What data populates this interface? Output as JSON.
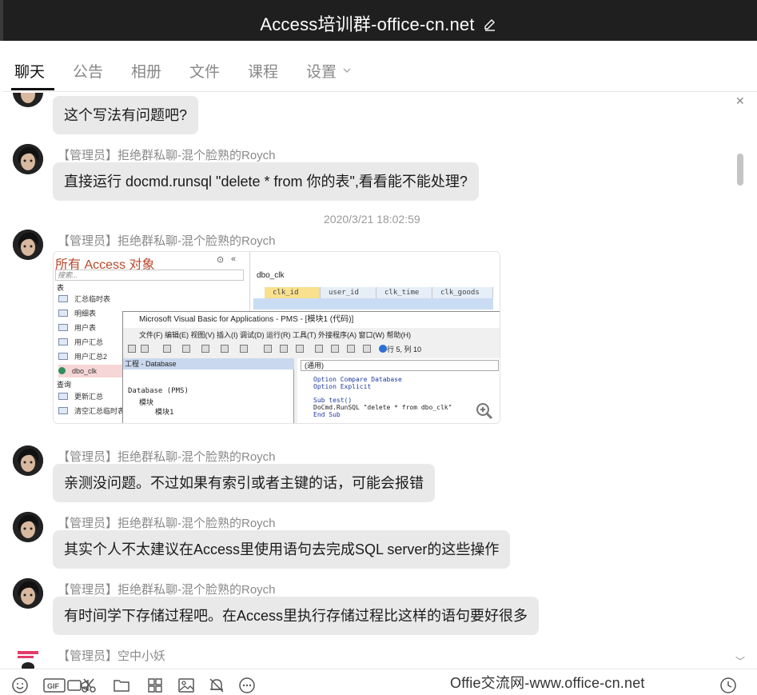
{
  "window": {
    "title": "Access培训群-office-cn.net"
  },
  "tabs": [
    {
      "label": "聊天"
    },
    {
      "label": "公告"
    },
    {
      "label": "相册"
    },
    {
      "label": "文件"
    },
    {
      "label": "课程"
    },
    {
      "label": "设置"
    }
  ],
  "messages": {
    "m1": {
      "text": "这个写法有问题吧?"
    },
    "m2": {
      "sender": "【管理员】拒绝群私聊-混个脸熟的Roych",
      "text": "直接运行 docmd.runsql \"delete * from 你的表\",看看能不能处理?"
    },
    "timestamp": "2020/3/21 18:02:59",
    "m3": {
      "sender": "【管理员】拒绝群私聊-混个脸熟的Roych"
    },
    "m4": {
      "sender": "【管理员】拒绝群私聊-混个脸熟的Roych",
      "text": "亲测没问题。不过如果有索引或者主键的话，可能会报错"
    },
    "m5": {
      "sender": "【管理员】拒绝群私聊-混个脸熟的Roych",
      "text": "其实个人不太建议在Access里使用语句去完成SQL server的这些操作"
    },
    "m6": {
      "sender": "【管理员】拒绝群私聊-混个脸熟的Roych",
      "text": "有时间学下存储过程吧。在Access里执行存储过程比这样的语句要好很多"
    },
    "m7": {
      "sender": "【管理员】空中小妖"
    }
  },
  "screenshot": {
    "nav": {
      "title": "所有 Access 对象",
      "search_placeholder": "搜索...",
      "section_tables": "表",
      "section_queries": "查询",
      "items": [
        "汇总临时表",
        "明细表",
        "用户表",
        "用户汇总",
        "用户汇总2",
        "dbo_clk"
      ],
      "query_items": [
        "更新汇总",
        "清空汇总临时表"
      ]
    },
    "table": {
      "tab": "dbo_clk",
      "columns": [
        "clk_id",
        "user_id",
        "clk_time",
        "clk_goods"
      ]
    },
    "vbe": {
      "title": "Microsoft Visual Basic for Applications - PMS - [模块1 (代码)]",
      "menu": "文件(F)   编辑(E)   视图(V)   插入(I)   调试(D)   运行(R)   工具(T)   外接程序(A)   窗口(W)   帮助(H)",
      "position": "行 5, 列 10",
      "project_title": "工程 - Database",
      "project_lines": [
        "Database (PMS)",
        "模块",
        "模块1"
      ],
      "general": "(通用)",
      "code": [
        "Option Compare Database",
        "Option Explicit",
        "",
        "Sub test()",
        "    DoCmd.RunSQL \"delete * from dbo_clk\"",
        "End Sub"
      ]
    }
  },
  "watermark": "Offie交流网-www.office-cn.net",
  "icons": {
    "edit": "pencil-icon",
    "settings_chevron": "chevron-down-icon",
    "zoom": "zoom-in-icon"
  }
}
